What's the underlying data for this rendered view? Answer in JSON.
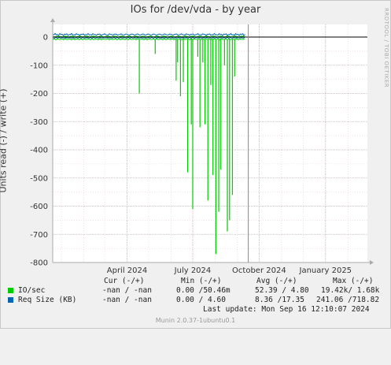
{
  "chart_data": {
    "type": "line",
    "title": "IOs for /dev/vda - by year",
    "ylabel": "Units read (-) / write (+)",
    "ylim": [
      -800,
      20
    ],
    "yticks": [
      0,
      -100,
      -200,
      -300,
      -400,
      -500,
      -600,
      -700,
      -800
    ],
    "xticks": [
      "April 2024",
      "July 2024",
      "October 2024",
      "January 2025"
    ],
    "series": [
      {
        "name": "IO/sec",
        "color": "#00cc00",
        "read_dips": [
          {
            "date": "2024-04-18",
            "value": -200
          },
          {
            "date": "2024-05-10",
            "value": -60
          },
          {
            "date": "2024-06-08",
            "value": -155
          },
          {
            "date": "2024-06-10",
            "value": -90
          },
          {
            "date": "2024-06-14",
            "value": -210
          },
          {
            "date": "2024-06-18",
            "value": -160
          },
          {
            "date": "2024-06-24",
            "value": -480
          },
          {
            "date": "2024-06-29",
            "value": -310
          },
          {
            "date": "2024-07-01",
            "value": -610
          },
          {
            "date": "2024-07-08",
            "value": -70
          },
          {
            "date": "2024-07-11",
            "value": -320
          },
          {
            "date": "2024-07-15",
            "value": -90
          },
          {
            "date": "2024-07-18",
            "value": -310
          },
          {
            "date": "2024-07-22",
            "value": -580
          },
          {
            "date": "2024-07-26",
            "value": -170
          },
          {
            "date": "2024-07-29",
            "value": -490
          },
          {
            "date": "2024-08-02",
            "value": -770
          },
          {
            "date": "2024-08-06",
            "value": -620
          },
          {
            "date": "2024-08-09",
            "value": -470
          },
          {
            "date": "2024-08-14",
            "value": -100
          },
          {
            "date": "2024-08-18",
            "value": -690
          },
          {
            "date": "2024-08-21",
            "value": -650
          },
          {
            "date": "2024-08-25",
            "value": -560
          },
          {
            "date": "2024-08-28",
            "value": -140
          }
        ]
      },
      {
        "name": "Req Size (KB)",
        "color": "#0066b3"
      }
    ]
  },
  "legend": {
    "headers": {
      "cur": "Cur (-/+)",
      "min": "Min (-/+)",
      "avg": "Avg (-/+)",
      "max": "Max (-/+)"
    },
    "rows": [
      {
        "name": "IO/sec",
        "color": "#00cc00",
        "cur": "-nan / -nan",
        "min": "0.00 /50.46m",
        "avg": "52.39 / 4.80",
        "max": "19.42k/ 1.68k"
      },
      {
        "name": "Req Size (KB)",
        "color": "#0066b3",
        "cur": "-nan / -nan",
        "min": "0.00 / 4.60",
        "avg": "8.36 /17.35",
        "max": "241.06 /718.82"
      }
    ],
    "last_update": "Last update: Mon Sep 16 12:10:07 2024"
  },
  "watermark": "RRDTOOL / TOBI OETIKER",
  "footer": "Munin 2.0.37-1ubuntu0.1"
}
